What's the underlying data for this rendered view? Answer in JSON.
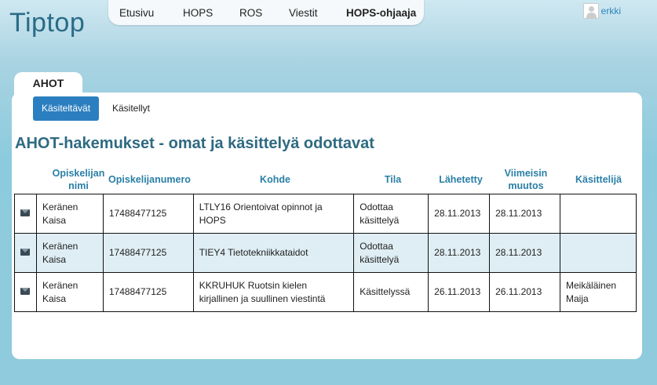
{
  "app": {
    "logo": "Tiptop"
  },
  "nav": {
    "items": [
      {
        "label": "Etusivu"
      },
      {
        "label": "HOPS"
      },
      {
        "label": "ROS"
      },
      {
        "label": "Viestit"
      },
      {
        "label": "HOPS-ohjaaja"
      }
    ],
    "active": "HOPS-ohjaaja"
  },
  "user": {
    "name": "erkki"
  },
  "section_tab": {
    "label": "AHOT"
  },
  "subtabs": {
    "active": "Käsiteltävät",
    "inactive": "Käsitellyt"
  },
  "page": {
    "title": "AHOT-hakemukset - omat ja käsittelyä odottavat"
  },
  "table": {
    "headers": [
      {
        "line1": "Opiskelijan",
        "line2": "nimi"
      },
      {
        "line1": "Opiskelijanumero",
        "line2": ""
      },
      {
        "line1": "Kohde",
        "line2": ""
      },
      {
        "line1": "Tila",
        "line2": ""
      },
      {
        "line1": "Lähetetty",
        "line2": ""
      },
      {
        "line1": "Viimeisin",
        "line2": "muutos"
      },
      {
        "line1": "Käsittelijä",
        "line2": ""
      }
    ],
    "rows": [
      {
        "name1": "Keränen",
        "name2": "Kaisa",
        "number": "17488477125",
        "target1": "LTLY16 Orientoivat opinnot ja",
        "target2": "HOPS",
        "status1": "Odottaa",
        "status2": "käsittelyä",
        "sent": "28.11.2013",
        "changed": "28.11.2013",
        "handler1": "",
        "handler2": ""
      },
      {
        "name1": "Keränen",
        "name2": "Kaisa",
        "number": "17488477125",
        "target1": "TIEY4 Tietotekniikkataidot",
        "target2": "",
        "status1": "Odottaa",
        "status2": "käsittelyä",
        "sent": "28.11.2013",
        "changed": "28.11.2013",
        "handler1": "",
        "handler2": ""
      },
      {
        "name1": "Keränen",
        "name2": "Kaisa",
        "number": "17488477125",
        "target1": "KKRUHUK Ruotsin kielen",
        "target2": "kirjallinen ja suullinen viestintä",
        "status1": "Käsittelyssä",
        "status2": "",
        "sent": "26.11.2013",
        "changed": "26.11.2013",
        "handler1": "Meikäläinen",
        "handler2": "Maija"
      }
    ]
  },
  "icons": {
    "row_action": "mail-icon"
  },
  "colors": {
    "accent": "#2b7fc0",
    "heading": "#2e6a82",
    "header_text": "#2a7fa6",
    "row_alt": "#dfeef4"
  }
}
